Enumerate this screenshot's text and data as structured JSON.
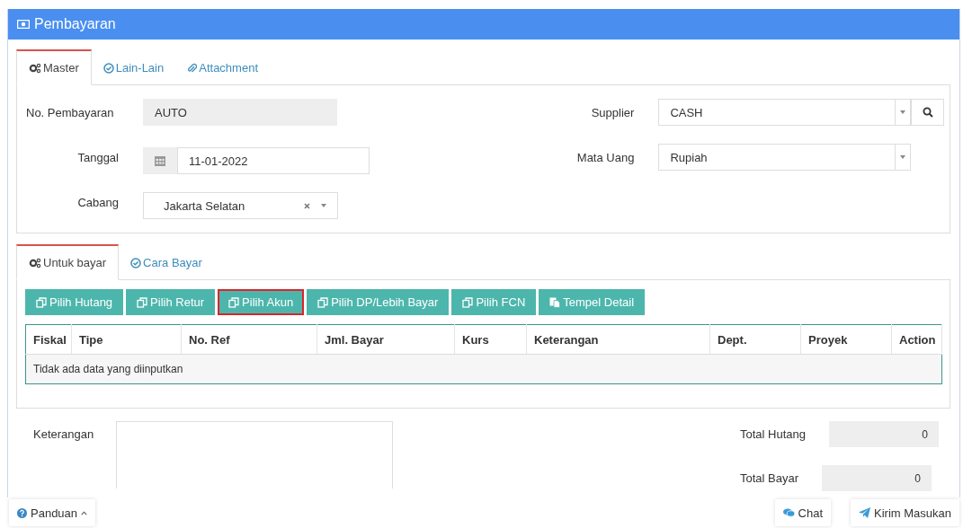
{
  "panel": {
    "title": "Pembayaran"
  },
  "master_tabs": [
    {
      "label": "Master",
      "selected": true
    },
    {
      "label": "Lain-Lain",
      "selected": false
    },
    {
      "label": "Attachment",
      "selected": false
    }
  ],
  "fields_left": [
    {
      "label": "No. Pembayaran",
      "value": "AUTO",
      "kind": "readonly"
    },
    {
      "label": "Tanggal",
      "value": "11-01-2022",
      "kind": "date"
    },
    {
      "label": "Cabang",
      "value": "Jakarta Selatan",
      "kind": "select-clear"
    }
  ],
  "fields_right": [
    {
      "label": "Supplier",
      "value": "CASH",
      "kind": "select-search"
    },
    {
      "label": "Mata Uang",
      "value": "Rupiah",
      "kind": "select"
    }
  ],
  "detail_tabs": [
    {
      "label": "Untuk bayar",
      "selected": true
    },
    {
      "label": "Cara Bayar",
      "selected": false
    }
  ],
  "action_buttons": [
    {
      "label": "Pilih Hutang",
      "kind": "pick",
      "highlighted": false
    },
    {
      "label": "Pilih Retur",
      "kind": "pick",
      "highlighted": false
    },
    {
      "label": "Pilih Akun",
      "kind": "pick",
      "highlighted": true
    },
    {
      "label": "Pilih DP/Lebih Bayar",
      "kind": "pick",
      "highlighted": false
    },
    {
      "label": "Pilih FCN",
      "kind": "pick",
      "highlighted": false
    },
    {
      "label": "Tempel Detail",
      "kind": "paste",
      "highlighted": false
    }
  ],
  "table": {
    "columns": [
      "Fiskal",
      "Tipe",
      "No. Ref",
      "Jml. Bayar",
      "Kurs",
      "Keterangan",
      "Dept.",
      "Proyek",
      "Action"
    ],
    "empty_message": "Tidak ada data yang diinputkan"
  },
  "notes": {
    "label": "Keterangan"
  },
  "totals": [
    {
      "label": "Total Hutang",
      "value": "0"
    },
    {
      "label": "Total Bayar",
      "value": "0"
    }
  ],
  "footer": {
    "guide": "Panduan",
    "chat": "Chat",
    "feedback": "Kirim Masukan"
  }
}
